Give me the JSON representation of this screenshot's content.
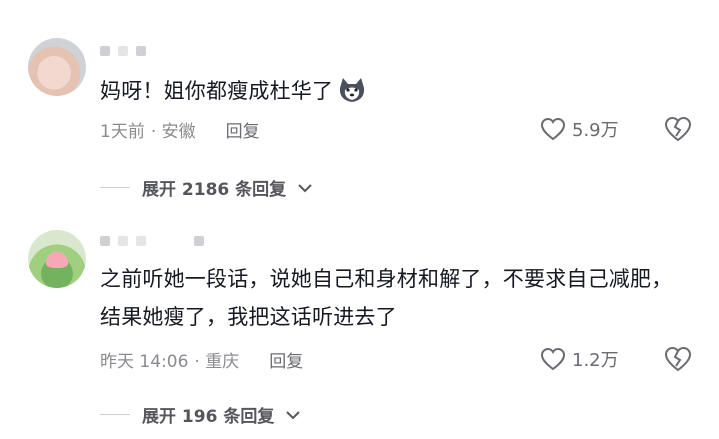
{
  "comments": [
    {
      "text": "妈呀！姐你都瘦成杜华了",
      "emoji": "husky-dog-emoji",
      "time": "1天前",
      "location": "· 安徽",
      "reply_label": "回复",
      "likes": "5.9万",
      "expand_label": "展开 2186 条回复"
    },
    {
      "text": "之前听她一段话，说她自己和身材和解了，不要求自己减肥，结果她瘦了，我把这话听进去了",
      "time": "昨天 14:06",
      "location": "· 重庆",
      "reply_label": "回复",
      "likes": "1.2万",
      "expand_label": "展开 196 条回复"
    }
  ],
  "icons": {
    "like": "heart-outline-icon",
    "dislike": "broken-heart-icon",
    "expand": "chevron-down-icon"
  },
  "colors": {
    "text": "#161823",
    "meta": "#8a8b91",
    "background": "#ffffff"
  }
}
